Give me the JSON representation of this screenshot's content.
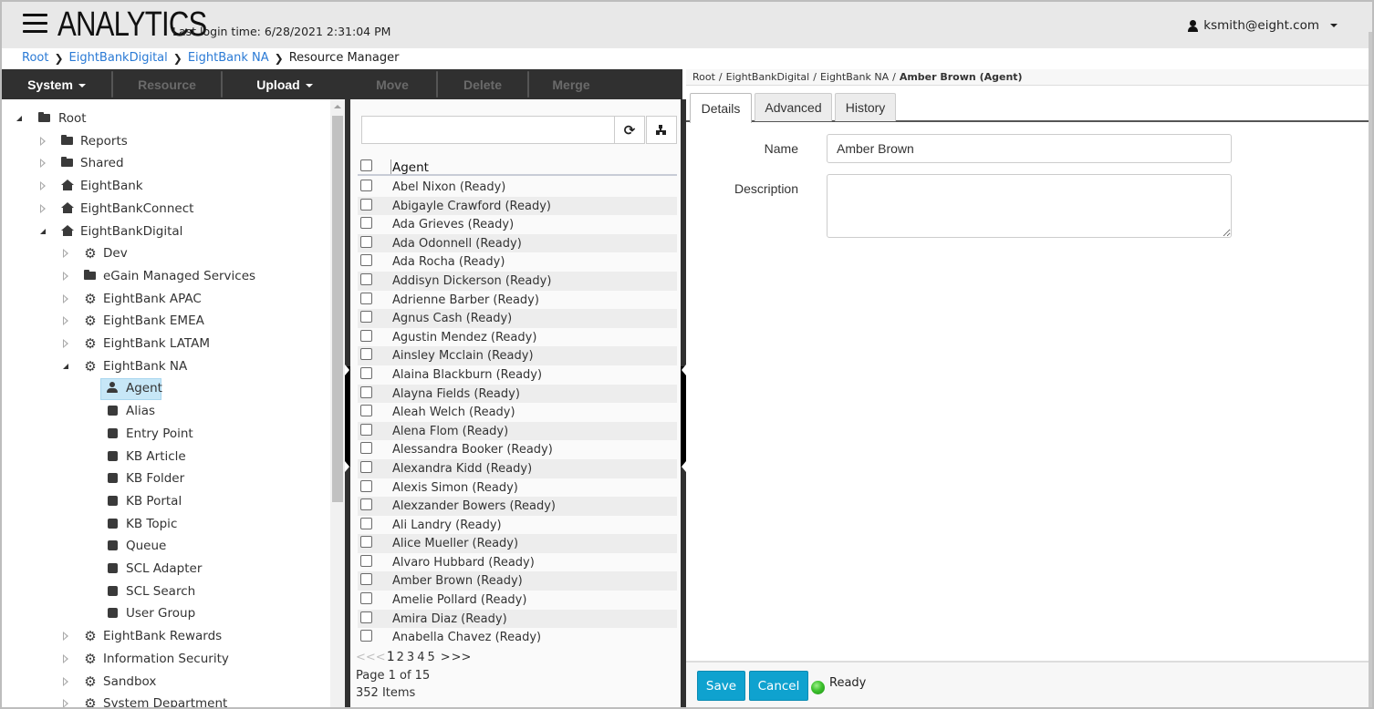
{
  "header": {
    "app_title": "ANALYTICS",
    "last_login": "Last login time: 6/28/2021 2:31:04 PM",
    "user": "ksmith@eight.com",
    "icons": {
      "menu": "hamburger-icon",
      "user": "user-icon",
      "dropdown": "caret-down-icon"
    }
  },
  "breadcrumb": {
    "items": [
      "Root",
      "EightBankDigital",
      "EightBank NA"
    ],
    "current": "Resource Manager"
  },
  "toolbar": {
    "system": "System",
    "resource": "Resource",
    "upload": "Upload",
    "move": "Move",
    "delete": "Delete",
    "merge": "Merge"
  },
  "tree": {
    "nodes": [
      {
        "label": "Root",
        "icon": "folder",
        "toggle": "expanded",
        "level": 0
      },
      {
        "label": "Reports",
        "icon": "folder",
        "toggle": "collapsed",
        "level": 1
      },
      {
        "label": "Shared",
        "icon": "folder",
        "toggle": "collapsed",
        "level": 1
      },
      {
        "label": "EightBank",
        "icon": "home",
        "toggle": "collapsed",
        "level": 1
      },
      {
        "label": "EightBankConnect",
        "icon": "home",
        "toggle": "collapsed",
        "level": 1
      },
      {
        "label": "EightBankDigital",
        "icon": "home",
        "toggle": "expanded",
        "level": 1
      },
      {
        "label": "Dev",
        "icon": "gear",
        "toggle": "collapsed",
        "level": 2
      },
      {
        "label": "eGain Managed Services",
        "icon": "folder",
        "toggle": "collapsed",
        "level": 2
      },
      {
        "label": "EightBank APAC",
        "icon": "gear",
        "toggle": "collapsed",
        "level": 2
      },
      {
        "label": "EightBank EMEA",
        "icon": "gear",
        "toggle": "collapsed",
        "level": 2
      },
      {
        "label": "EightBank LATAM",
        "icon": "gear",
        "toggle": "collapsed",
        "level": 2
      },
      {
        "label": "EightBank NA",
        "icon": "gear",
        "toggle": "expanded",
        "level": 2
      },
      {
        "label": "Agent",
        "icon": "person",
        "toggle": "none",
        "level": 3,
        "selected": true
      },
      {
        "label": "Alias",
        "icon": "square",
        "toggle": "none",
        "level": 3
      },
      {
        "label": "Entry Point",
        "icon": "square",
        "toggle": "none",
        "level": 3
      },
      {
        "label": "KB Article",
        "icon": "square",
        "toggle": "none",
        "level": 3
      },
      {
        "label": "KB Folder",
        "icon": "square",
        "toggle": "none",
        "level": 3
      },
      {
        "label": "KB Portal",
        "icon": "square",
        "toggle": "none",
        "level": 3
      },
      {
        "label": "KB Topic",
        "icon": "square",
        "toggle": "none",
        "level": 3
      },
      {
        "label": "Queue",
        "icon": "square",
        "toggle": "none",
        "level": 3
      },
      {
        "label": "SCL Adapter",
        "icon": "square",
        "toggle": "none",
        "level": 3
      },
      {
        "label": "SCL Search",
        "icon": "square",
        "toggle": "none",
        "level": 3
      },
      {
        "label": "User Group",
        "icon": "square",
        "toggle": "none",
        "level": 3
      },
      {
        "label": "EightBank Rewards",
        "icon": "gear",
        "toggle": "collapsed",
        "level": 2
      },
      {
        "label": "Information Security",
        "icon": "gear",
        "toggle": "collapsed",
        "level": 2
      },
      {
        "label": "Sandbox",
        "icon": "gear",
        "toggle": "collapsed",
        "level": 2
      },
      {
        "label": "System Department",
        "icon": "gear",
        "toggle": "collapsed",
        "level": 2
      }
    ]
  },
  "list": {
    "search_value": "",
    "column_header": "Agent",
    "agents": [
      "Abel Nixon (Ready)",
      "Abigayle Crawford (Ready)",
      "Ada Grieves (Ready)",
      "Ada Odonnell (Ready)",
      "Ada Rocha (Ready)",
      "Addisyn Dickerson (Ready)",
      "Adrienne Barber (Ready)",
      "Agnus Cash (Ready)",
      "Agustin Mendez (Ready)",
      "Ainsley Mcclain (Ready)",
      "Alaina Blackburn (Ready)",
      "Alayna Fields (Ready)",
      "Aleah Welch (Ready)",
      "Alena Flom (Ready)",
      "Alessandra Booker (Ready)",
      "Alexandra Kidd (Ready)",
      "Alexis Simon (Ready)",
      "Alexzander Bowers (Ready)",
      "Ali Landry (Ready)",
      "Alice Mueller (Ready)",
      "Alvaro Hubbard (Ready)",
      "Amber Brown (Ready)",
      "Amelie Pollard (Ready)",
      "Amira Diaz (Ready)",
      "Anabella Chavez (Ready)"
    ],
    "pager": {
      "first": "<<",
      "prev": "<",
      "current": "1",
      "pages": [
        "2",
        "3",
        "4",
        "5"
      ],
      "next": ">",
      "last": ">>"
    },
    "page_info": "Page 1 of 15",
    "items_info": "352 Items"
  },
  "detail": {
    "breadcrumb": [
      "Root",
      "EightBankDigital",
      "EightBank NA"
    ],
    "breadcrumb_current": "Amber Brown (Agent)",
    "tabs": [
      "Details",
      "Advanced",
      "History"
    ],
    "active_tab": "Details",
    "name_label": "Name",
    "name_value": "Amber Brown",
    "description_label": "Description",
    "description_value": "",
    "save": "Save",
    "cancel": "Cancel",
    "status": "Ready",
    "status_color": "#3cc12c"
  },
  "colors": {
    "toolbar_bg": "#303030",
    "link": "#2a7ad5",
    "primary_button": "#0fa2cf",
    "selected_node": "#c7e7f7"
  }
}
